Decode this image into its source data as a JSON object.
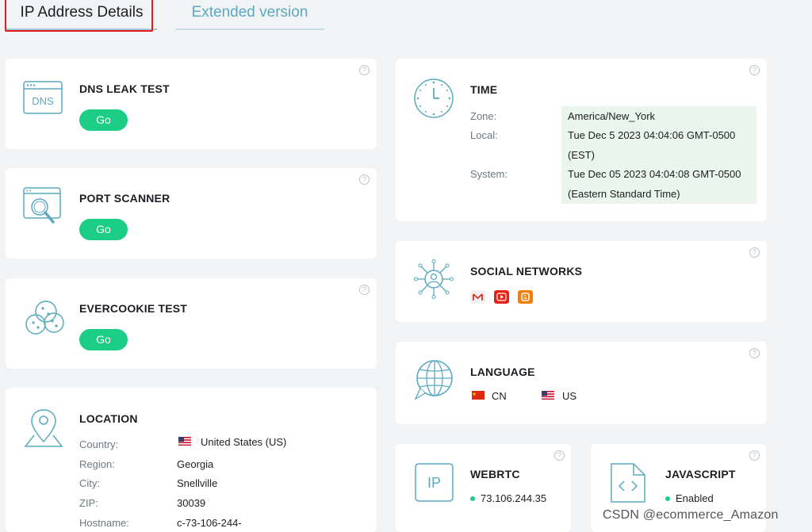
{
  "tabs": [
    {
      "label": "IP Address Details",
      "active": true
    },
    {
      "label": "Extended version",
      "active": false
    }
  ],
  "help_symbol": "?",
  "dns": {
    "title": "DNS LEAK TEST",
    "icon_text": "DNS",
    "go": "Go"
  },
  "port": {
    "title": "PORT SCANNER",
    "go": "Go"
  },
  "evercookie": {
    "title": "EVERCOOKIE TEST",
    "go": "Go"
  },
  "location": {
    "title": "LOCATION",
    "rows": [
      {
        "label": "Country:",
        "value": "United States (US)"
      },
      {
        "label": "Region:",
        "value": "Georgia"
      },
      {
        "label": "City:",
        "value": "Snellville"
      },
      {
        "label": "ZIP:",
        "value": "30039"
      },
      {
        "label": "Hostname:",
        "value": "c-73-106-244-"
      }
    ]
  },
  "time": {
    "title": "TIME",
    "zone_label": "Zone:",
    "zone_value": "America/New_York",
    "local_label": "Local:",
    "local_value_1": "Tue Dec 5 2023 04:04:06 GMT-0500",
    "local_value_2": "(EST)",
    "system_label": "System:",
    "system_value_1": "Tue Dec 05 2023 04:04:08 GMT-0500",
    "system_value_2": "(Eastern Standard Time)"
  },
  "social": {
    "title": "SOCIAL NETWORKS",
    "icons": [
      "gmail-icon",
      "youtube-icon",
      "blogger-icon"
    ],
    "colors": {
      "gmail": "#d93025",
      "youtube": "#e62117",
      "blogger": "#f57d00"
    }
  },
  "language": {
    "title": "LANGUAGE",
    "items": [
      {
        "code": "CN",
        "flag": "china-flag-icon"
      },
      {
        "code": "US",
        "flag": "us-flag-icon"
      }
    ]
  },
  "webrtc": {
    "title": "WEBRTC",
    "icon_text": "IP",
    "value": "73.106.244.35"
  },
  "javascript": {
    "title": "JAVASCRIPT",
    "icon_text": "< >",
    "value": "Enabled"
  },
  "watermark": "CSDN @ecommerce_Amazon",
  "colors": {
    "accent": "#1ccd86",
    "icon": "#5aaabf",
    "tab_link": "#5aaabf",
    "highlight": "#eaf6ed"
  }
}
